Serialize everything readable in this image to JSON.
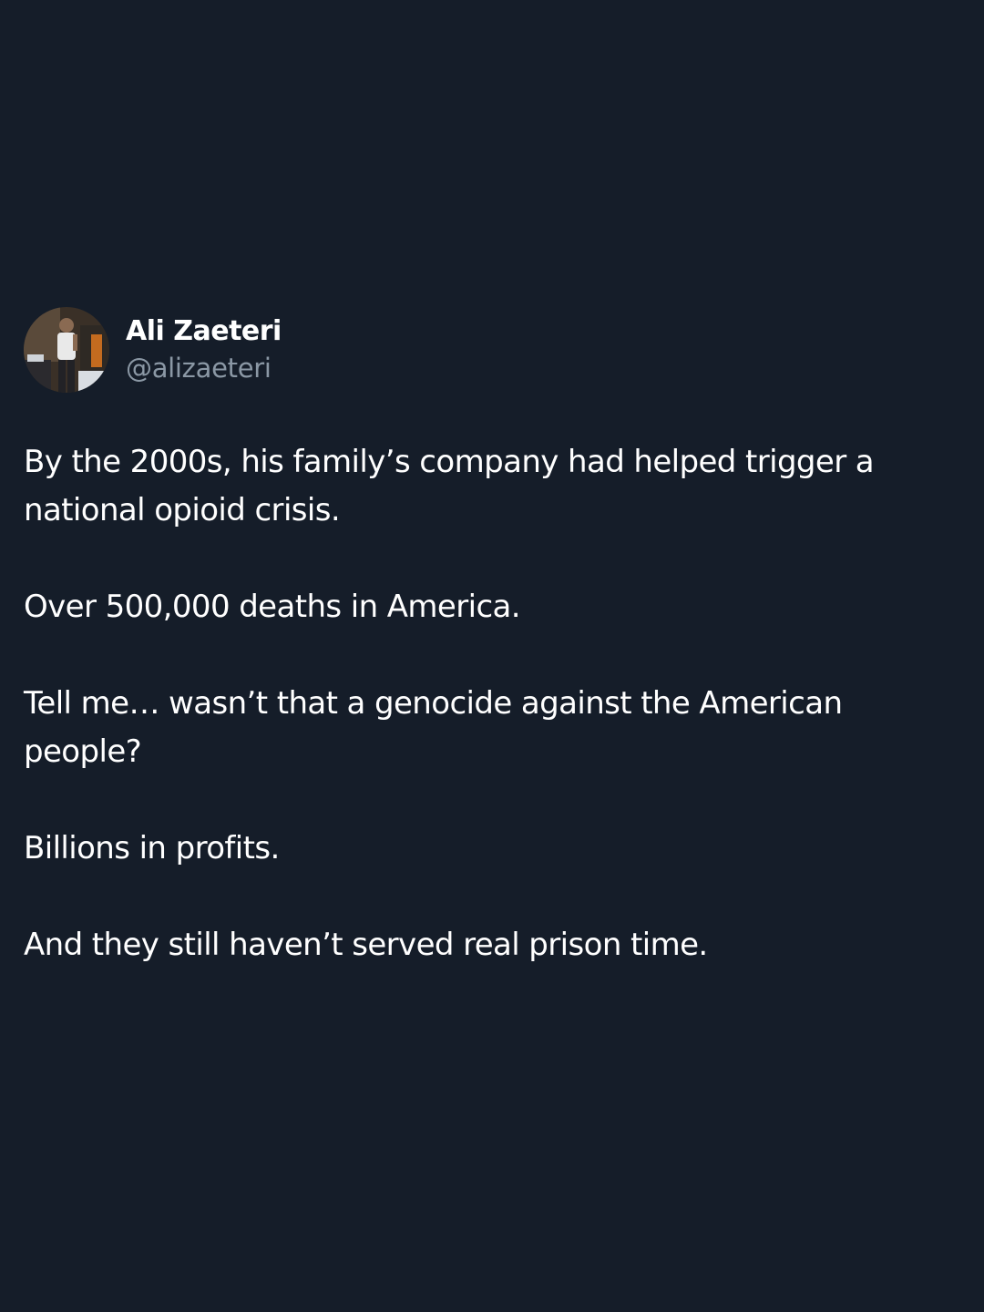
{
  "author": {
    "display_name": "Ali Zaeteri",
    "handle": "@alizaeteri",
    "avatar": "profile-photo"
  },
  "tweet": {
    "paragraphs": [
      "By the 2000s, his family’s company had helped trigger a national opioid crisis.",
      "Over 500,000 deaths in America.",
      "Tell me… wasn’t that a genocide against the American people?",
      "Billions in profits.",
      "And they still haven’t served real prison time."
    ]
  },
  "colors": {
    "background": "#151d29",
    "text_primary": "#ffffff",
    "text_secondary": "#8b98a5"
  }
}
